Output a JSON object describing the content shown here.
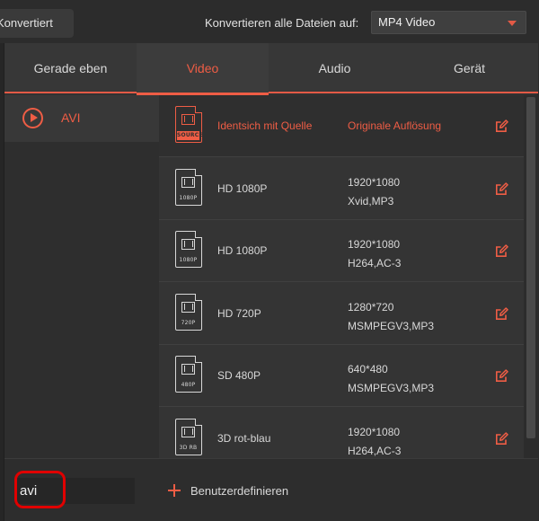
{
  "topbar": {
    "converted_tab": "Konvertiert",
    "convert_all_label": "Konvertieren alle Dateien auf:",
    "format_value": "MP4 Video"
  },
  "tabs": [
    {
      "label": "Gerade eben",
      "active": false
    },
    {
      "label": "Video",
      "active": true
    },
    {
      "label": "Audio",
      "active": false
    },
    {
      "label": "Gerät",
      "active": false
    }
  ],
  "categories": [
    {
      "label": "AVI",
      "icon": "play-circle-icon",
      "selected": true
    }
  ],
  "presets": [
    {
      "name": "Identsich mit Quelle",
      "spec1": "Originale Auflösung",
      "spec2": "",
      "tag": "SOURCE",
      "selected": true
    },
    {
      "name": "HD 1080P",
      "spec1": "1920*1080",
      "spec2": "Xvid,MP3",
      "tag": "1080P",
      "selected": false
    },
    {
      "name": "HD 1080P",
      "spec1": "1920*1080",
      "spec2": "H264,AC-3",
      "tag": "1080P",
      "selected": false
    },
    {
      "name": "HD 720P",
      "spec1": "1280*720",
      "spec2": "MSMPEGV3,MP3",
      "tag": "720P",
      "selected": false
    },
    {
      "name": "SD 480P",
      "spec1": "640*480",
      "spec2": "MSMPEGV3,MP3",
      "tag": "480P",
      "selected": false
    },
    {
      "name": "3D rot-blau",
      "spec1": "1920*1080",
      "spec2": "H264,AC-3",
      "tag": "3D RB",
      "selected": false
    }
  ],
  "bottom": {
    "search_value": "avi",
    "custom_label": "Benutzerdefinieren"
  },
  "colors": {
    "accent": "#ef5d45",
    "highlight": "#e00000"
  }
}
